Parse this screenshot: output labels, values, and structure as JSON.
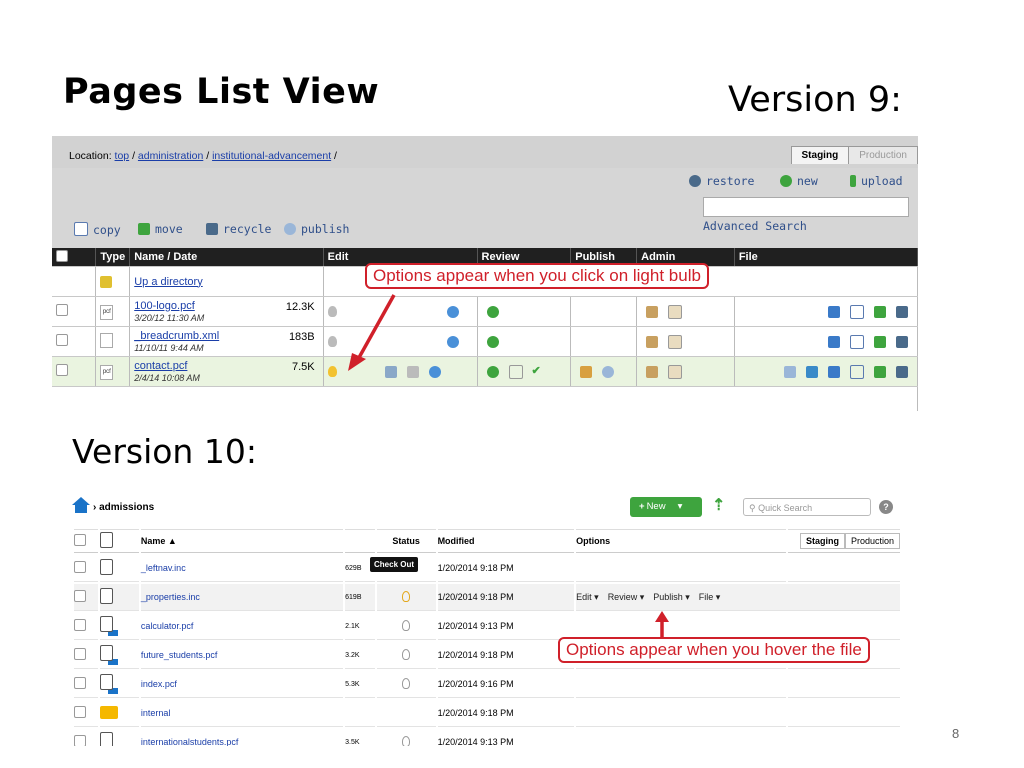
{
  "slide": {
    "title": "Pages List View",
    "version9_label": "Version 9:",
    "version10_label": "Version 10:",
    "page_number": "8"
  },
  "v9": {
    "location_prefix": "Location:",
    "crumbs": [
      "top",
      "administration",
      "institutional-advancement"
    ],
    "tabs": [
      "Staging",
      "Production"
    ],
    "actions": [
      "restore",
      "new",
      "upload"
    ],
    "advanced_search": "Advanced Search",
    "toolbar": [
      "copy",
      "move",
      "recycle",
      "publish"
    ],
    "columns": [
      "Type",
      "Name / Date",
      "Edit",
      "Review",
      "Publish",
      "Admin",
      "File"
    ],
    "up_dir": "Up a directory",
    "rows": [
      {
        "name": "100-logo.pcf",
        "date": "3/20/12 11:30 AM",
        "size": "12.3K",
        "type": "pcf"
      },
      {
        "name": "_breadcrumb.xml",
        "date": "11/10/11 9:44 AM",
        "size": "183B",
        "type": ""
      },
      {
        "name": "contact.pcf",
        "date": "2/4/14 10:08 AM",
        "size": "7.5K",
        "type": "pcf"
      }
    ],
    "callout": "Options appear when you click on light bulb"
  },
  "v10": {
    "breadcrumb": "admissions",
    "new_button": "New",
    "search_placeholder": "Quick Search",
    "columns": {
      "name": "Name ▲",
      "status": "Status",
      "modified": "Modified",
      "options": "Options"
    },
    "tabs": [
      "Staging",
      "Production"
    ],
    "tooltip": "Check Out",
    "options": [
      "Edit ▾",
      "Review ▾",
      "Publish ▾",
      "File ▾"
    ],
    "rows": [
      {
        "name": "_leftnav.inc",
        "size": "629B",
        "modified": "1/20/2014 9:18 PM",
        "kind": "doc"
      },
      {
        "name": "_properties.inc",
        "size": "619B",
        "modified": "1/20/2014 9:18 PM",
        "kind": "doc"
      },
      {
        "name": "calculator.pcf",
        "size": "2.1K",
        "modified": "1/20/2014 9:13 PM",
        "kind": "pdf"
      },
      {
        "name": "future_students.pcf",
        "size": "3.2K",
        "modified": "1/20/2014 9:18 PM",
        "kind": "pdf"
      },
      {
        "name": "index.pcf",
        "size": "5.3K",
        "modified": "1/20/2014 9:16 PM",
        "kind": "pdf"
      },
      {
        "name": "internal",
        "size": "",
        "modified": "1/20/2014 9:18 PM",
        "kind": "folder"
      },
      {
        "name": "internationalstudents.pcf",
        "size": "3.5K",
        "modified": "1/20/2014 9:13 PM",
        "kind": "pdf"
      }
    ],
    "callout": "Options appear when you hover the file"
  },
  "colors": {
    "callout_red": "#d0202a",
    "new_green": "#3ea43e",
    "house_blue": "#1a73c8",
    "header_dark": "#202020"
  }
}
